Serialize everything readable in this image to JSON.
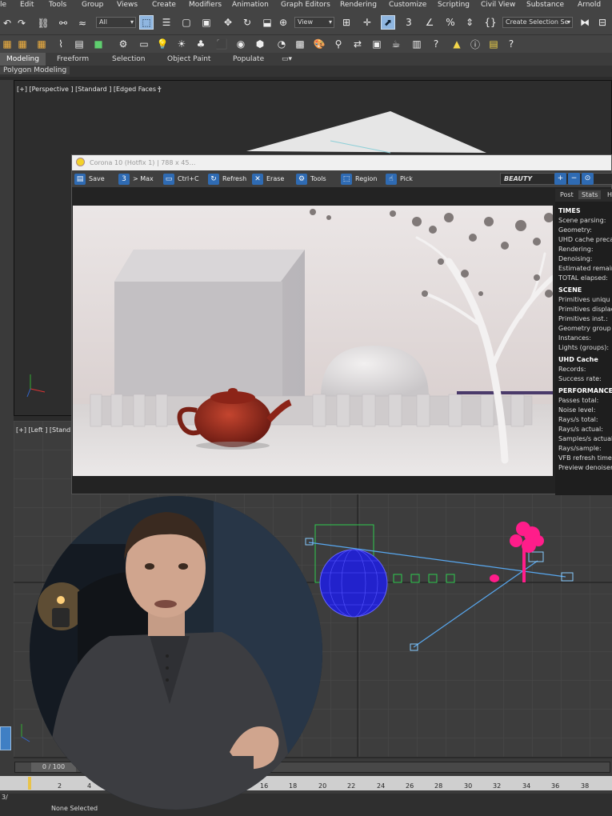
{
  "menu": [
    "le",
    "Edit",
    "Tools",
    "Group",
    "Views",
    "Create",
    "Modifiers",
    "Animation",
    "Graph Editors",
    "Rendering",
    "Customize",
    "Scripting",
    "Civil View",
    "Substance",
    "Arnold"
  ],
  "toolbar": {
    "filter_value": "All",
    "view_value": "View",
    "selection_set_value": "Create Selection Se"
  },
  "ribbon_tabs": [
    "Modeling",
    "Freeform",
    "Selection",
    "Object Paint",
    "Populate"
  ],
  "polybar_label": "Polygon Modeling",
  "viewport_persp_label": "[+] [Perspective ] [Standard ] [Edged Faces ]",
  "viewport_left_label": "[+] [Left ] [Stand",
  "vfb": {
    "title": "Corona 10 (Hotfix 1) | 788 x 45…",
    "buttons": [
      "Save",
      "> Max",
      "Ctrl+C",
      "Refresh",
      "Erase",
      "Tools",
      "Region",
      "Pick"
    ],
    "channel": "BEAUTY"
  },
  "stats": {
    "tabs": [
      "Post",
      "Stats",
      "H"
    ],
    "sections": [
      {
        "header": "TIMES",
        "rows": [
          "Scene parsing:",
          "Geometry:",
          "UHD cache preca",
          "Rendering:",
          "Denoising:",
          "Estimated remain",
          "TOTAL elapsed:"
        ]
      },
      {
        "header": "SCENE",
        "rows": [
          "Primitives uniqu",
          "Primitives displac",
          "Primitives inst.:",
          "Geometry group",
          "Instances:",
          "Lights (groups):"
        ]
      },
      {
        "header": "UHD Cache",
        "rows": [
          "Records:",
          "Success rate:"
        ]
      },
      {
        "header": "PERFORMANCE",
        "rows": [
          "Passes total:",
          "Noise level:",
          "Rays/s total:",
          "Rays/s actual:",
          "Samples/s actual",
          "Rays/sample:",
          "VFB refresh time",
          "Preview denoiser"
        ]
      }
    ]
  },
  "timeline": {
    "frame_range": "0 / 100",
    "ticks": [
      "2",
      "4",
      "16",
      "18",
      "20",
      "22",
      "24",
      "26",
      "28",
      "30",
      "32",
      "34",
      "36",
      "38"
    ]
  },
  "status": {
    "selection": "None Selected",
    "left_text": "3/"
  }
}
